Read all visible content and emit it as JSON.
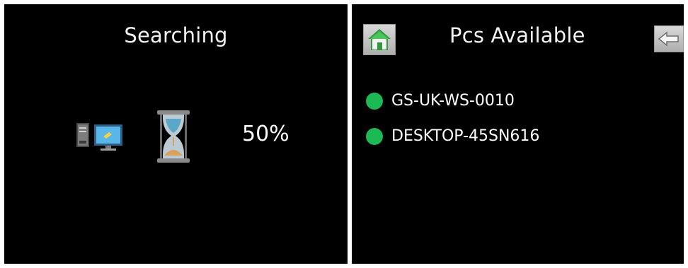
{
  "searching_panel": {
    "title": "Searching",
    "progress_percent_text": "50%",
    "progress": 0.5,
    "icons": [
      "computer-icon",
      "hourglass-icon"
    ]
  },
  "pcs_panel": {
    "title": "Pcs Available",
    "home_button_icon": "home-icon",
    "back_button_icon": "back-arrow-icon",
    "pcs": [
      {
        "name": "GS-UK-WS-0010",
        "status_color": "#1db954"
      },
      {
        "name": "DESKTOP-45SN616",
        "status_color": "#1db954"
      }
    ]
  },
  "colors": {
    "background": "#000000",
    "text": "#ffffff",
    "status_online": "#1db954",
    "button_face": "#c8c8c8"
  }
}
